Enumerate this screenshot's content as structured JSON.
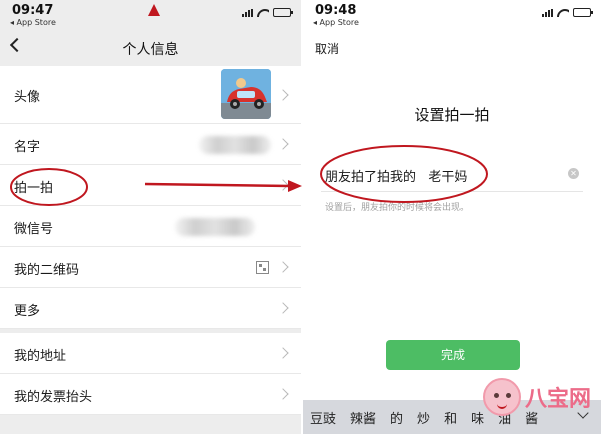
{
  "left": {
    "status": {
      "time": "09:47",
      "back_app": "◂ App Store"
    },
    "nav": {
      "title": "个人信息"
    },
    "rows": [
      {
        "label": "头像"
      },
      {
        "label": "名字"
      },
      {
        "label": "拍一拍"
      },
      {
        "label": "微信号"
      },
      {
        "label": "我的二维码"
      },
      {
        "label": "更多"
      }
    ],
    "rows2": [
      {
        "label": "我的地址"
      },
      {
        "label": "我的发票抬头"
      }
    ]
  },
  "right": {
    "status": {
      "time": "09:48",
      "back_app": "◂ App Store"
    },
    "cancel_label": "取消",
    "title": "设置拍一拍",
    "pat_text": "朋友拍了拍我的   老干妈",
    "hint": "设置后，朋友拍你的时候将会出现。",
    "done_label": "完成",
    "keyboard_candidates": [
      "豆豉",
      "辣酱",
      "的",
      "炒",
      "和",
      "味",
      "油",
      "酱"
    ]
  },
  "watermark": {
    "text": "八宝网"
  },
  "colors": {
    "annotation_red": "#c0171f",
    "wechat_green": "#4dbd64",
    "list_bg": "#ededed"
  },
  "battery_level": 0.85
}
